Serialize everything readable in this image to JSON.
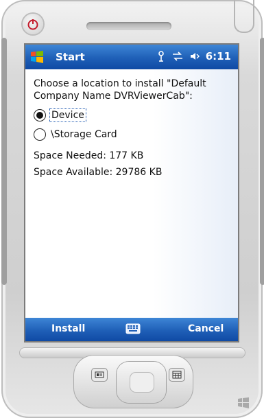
{
  "title_bar": {
    "app_name": "Start",
    "time": "6:11",
    "icons": [
      "windows-flag-icon",
      "signal-icon",
      "sync-icon",
      "volume-icon"
    ]
  },
  "content": {
    "prompt": "Choose a location to install \"Default Company Name DVRViewerCab\":",
    "options": [
      {
        "label": "Device",
        "selected": true
      },
      {
        "label": "\\Storage Card",
        "selected": false
      }
    ],
    "space_needed": "Space Needed:  177 KB",
    "space_available": "Space Available: 29786 KB"
  },
  "menu": {
    "left": "Install",
    "right": "Cancel",
    "center_icon": "keyboard-icon"
  },
  "colors": {
    "title_blue": "#1f5fb7",
    "screen_bg": "#ffffff",
    "device_gray": "#d9d9d9"
  }
}
